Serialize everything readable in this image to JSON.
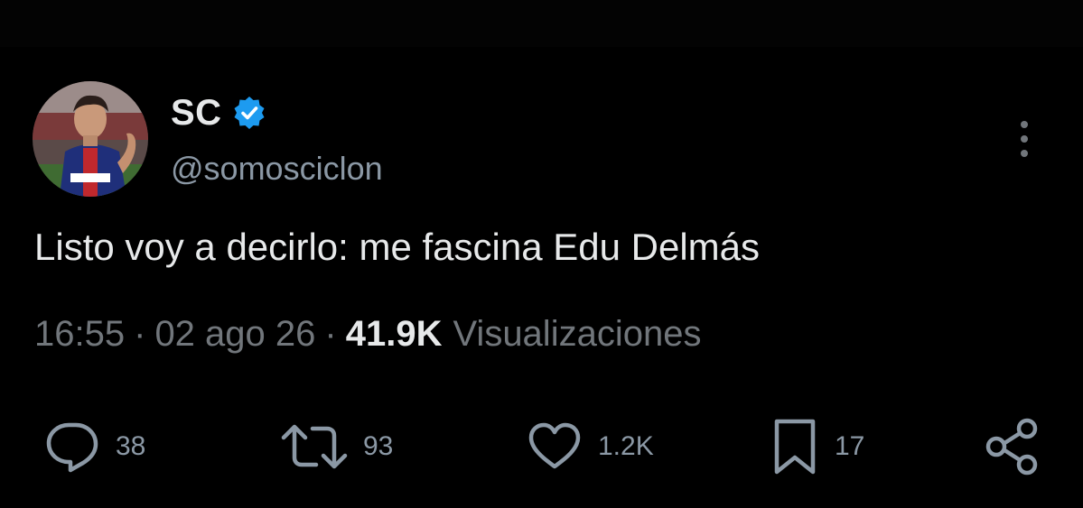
{
  "author": {
    "name": "SC",
    "handle": "@somosciclon",
    "verified": true,
    "badge_color": "#1d9bf0"
  },
  "tweet": {
    "text": "Listo voy a decirlo: me fascina Edu Delmás",
    "time": "16:55",
    "separator": "·",
    "date": "02 ago 26",
    "views_count": "41.9K",
    "views_label": "Visualizaciones"
  },
  "actions": {
    "reply": {
      "icon": "reply-icon",
      "count": "38"
    },
    "retweet": {
      "icon": "retweet-icon",
      "count": "93"
    },
    "like": {
      "icon": "heart-icon",
      "count": "1.2K"
    },
    "bookmark": {
      "icon": "bookmark-icon",
      "count": "17"
    },
    "share": {
      "icon": "share-icon"
    }
  },
  "colors": {
    "background": "#000000",
    "text_primary": "#e7e9ea",
    "text_secondary": "#71767b",
    "accent": "#1d9bf0"
  }
}
